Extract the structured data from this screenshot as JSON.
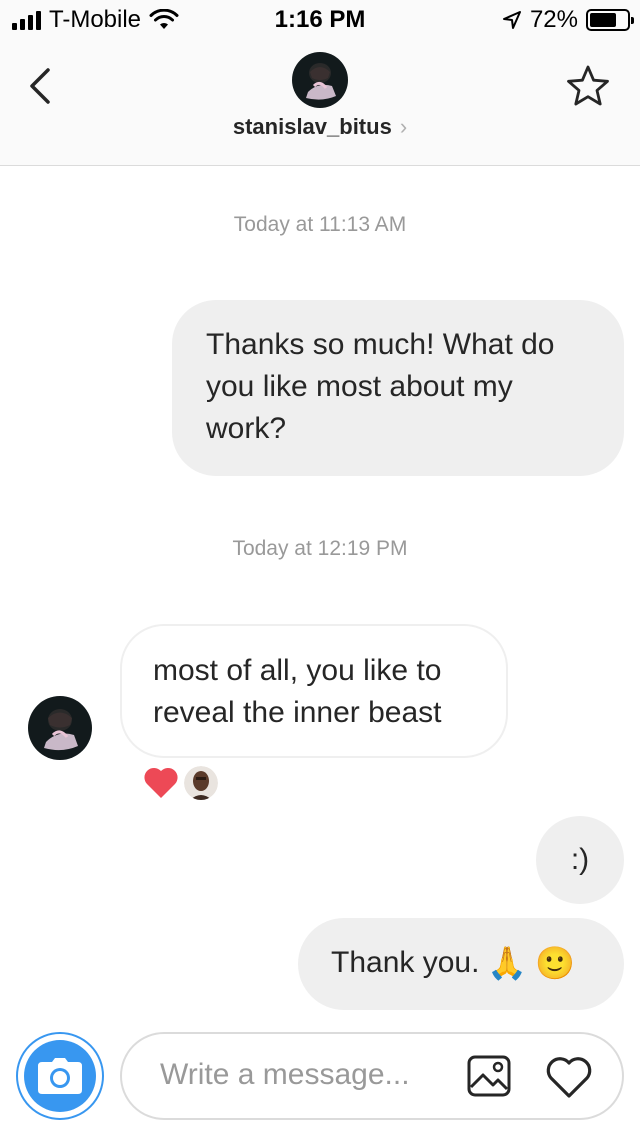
{
  "status_bar": {
    "carrier": "T-Mobile",
    "time": "1:16 PM",
    "battery_percent": "72%",
    "battery_level": 0.72
  },
  "header": {
    "username": "stanislav_bitus",
    "username_chevron": "›",
    "back_icon": "chevron-left-icon",
    "star_icon": "star-outline-icon"
  },
  "conversation": {
    "timestamp_1": "Today at 11:13 AM",
    "message_1": {
      "sender": "me",
      "lines": [
        "Thanks so much! What do",
        "you like most about my",
        "work?"
      ]
    },
    "timestamp_2": "Today at 12:19 PM",
    "message_2": {
      "sender": "them",
      "lines": [
        "most of all, you like to",
        "reveal the inner beast"
      ],
      "reaction_icon": "heart-icon"
    },
    "message_3": {
      "sender": "me",
      "text": ":)"
    },
    "message_4": {
      "sender": "me",
      "text": "Thank you.",
      "emoji_1": "🙏",
      "emoji_2": "🙂"
    }
  },
  "composer": {
    "placeholder": "Write a message...",
    "camera_icon": "camera-icon",
    "gallery_icon": "image-icon",
    "like_icon": "heart-outline-icon"
  },
  "colors": {
    "accent": "#3897f0",
    "bubble_me": "#efefef",
    "reaction_heart": "#ed4956",
    "timestamp": "#999999"
  }
}
